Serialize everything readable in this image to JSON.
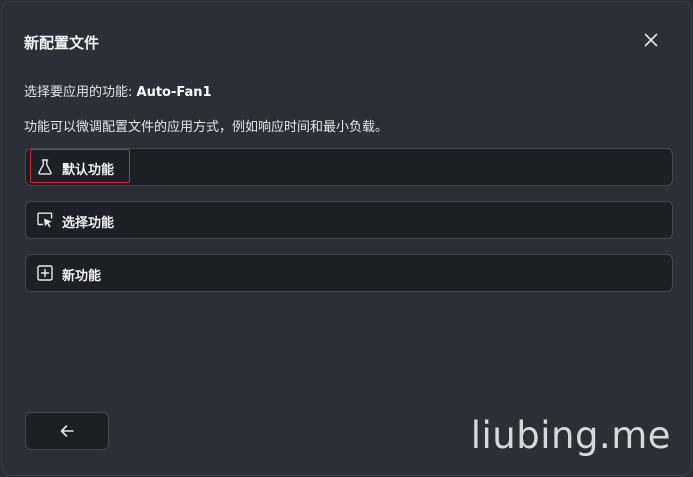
{
  "dialog": {
    "title": "新配置文件",
    "close_icon": "close-icon",
    "subtitle_prefix": "选择要应用的功能: ",
    "profile_name": "Auto-Fan1",
    "description": "功能可以微调配置文件的应用方式，例如响应时间和最小负载。"
  },
  "options": [
    {
      "label": "默认功能",
      "icon": "flask-icon"
    },
    {
      "label": "选择功能",
      "icon": "cursor-select-icon"
    },
    {
      "label": "新功能",
      "icon": "plus-square-icon"
    }
  ],
  "back_button": {
    "icon": "arrow-left-icon"
  },
  "watermark": "liubing.me",
  "colors": {
    "background": "#2c2f38",
    "option_background": "#1d1f26",
    "option_border": "#454852",
    "highlight": "#d8262e"
  }
}
